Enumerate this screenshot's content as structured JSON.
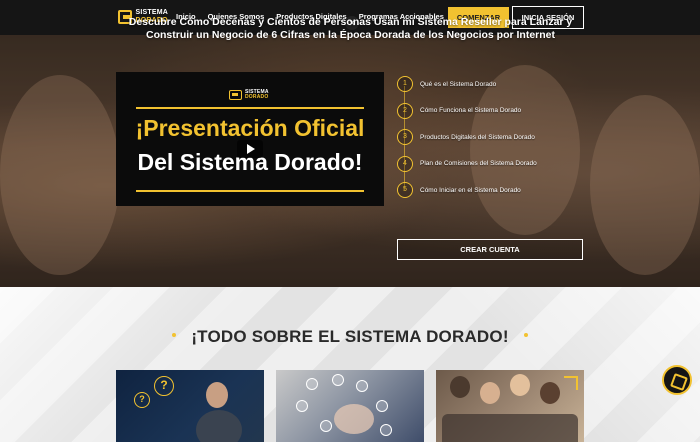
{
  "header": {
    "logo": {
      "line1": "SISTEMA",
      "line2": "DORADO"
    },
    "nav": [
      "Inicio",
      "Quienes Somos",
      "Productos Digitales",
      "Programas Accionables"
    ],
    "close_glyph": "✕",
    "cta_primary": "COMENZAR",
    "cta_secondary": "INICIA SESIÓN"
  },
  "hero": {
    "title": "Descubre Cómo Decenas y Cientos de Personas Usan mi Sistema Reseller para Lanzar y Construir un Negocio de 6 Cifras en la Época Dorada de los Negocios por Internet",
    "video": {
      "logo": {
        "line1": "SISTEMA",
        "line2": "DORADO"
      },
      "line1": "¡Presentación Oficial",
      "line2": "Del Sistema Dorado!"
    },
    "steps": [
      {
        "num": "1",
        "label": "Qué es el Sistema Dorado"
      },
      {
        "num": "2",
        "label": "Cómo Funciona el Sistema Dorado"
      },
      {
        "num": "3",
        "label": "Productos Digitales del Sistema Dorado"
      },
      {
        "num": "4",
        "label": "Plan de Comisiones del Sistema Dorado"
      },
      {
        "num": "5",
        "label": "Cómo Iniciar en el Sistema Dorado"
      }
    ],
    "cta": "CREAR CUENTA"
  },
  "section": {
    "title": "¡TODO SOBRE EL SISTEMA DORADO!"
  },
  "cards": [
    {
      "icon": "question-icon",
      "glyph": "?"
    },
    {
      "icon": "network-icon"
    },
    {
      "icon": "team-icon"
    }
  ],
  "colors": {
    "accent": "#f2c230",
    "dark": "#151515"
  }
}
